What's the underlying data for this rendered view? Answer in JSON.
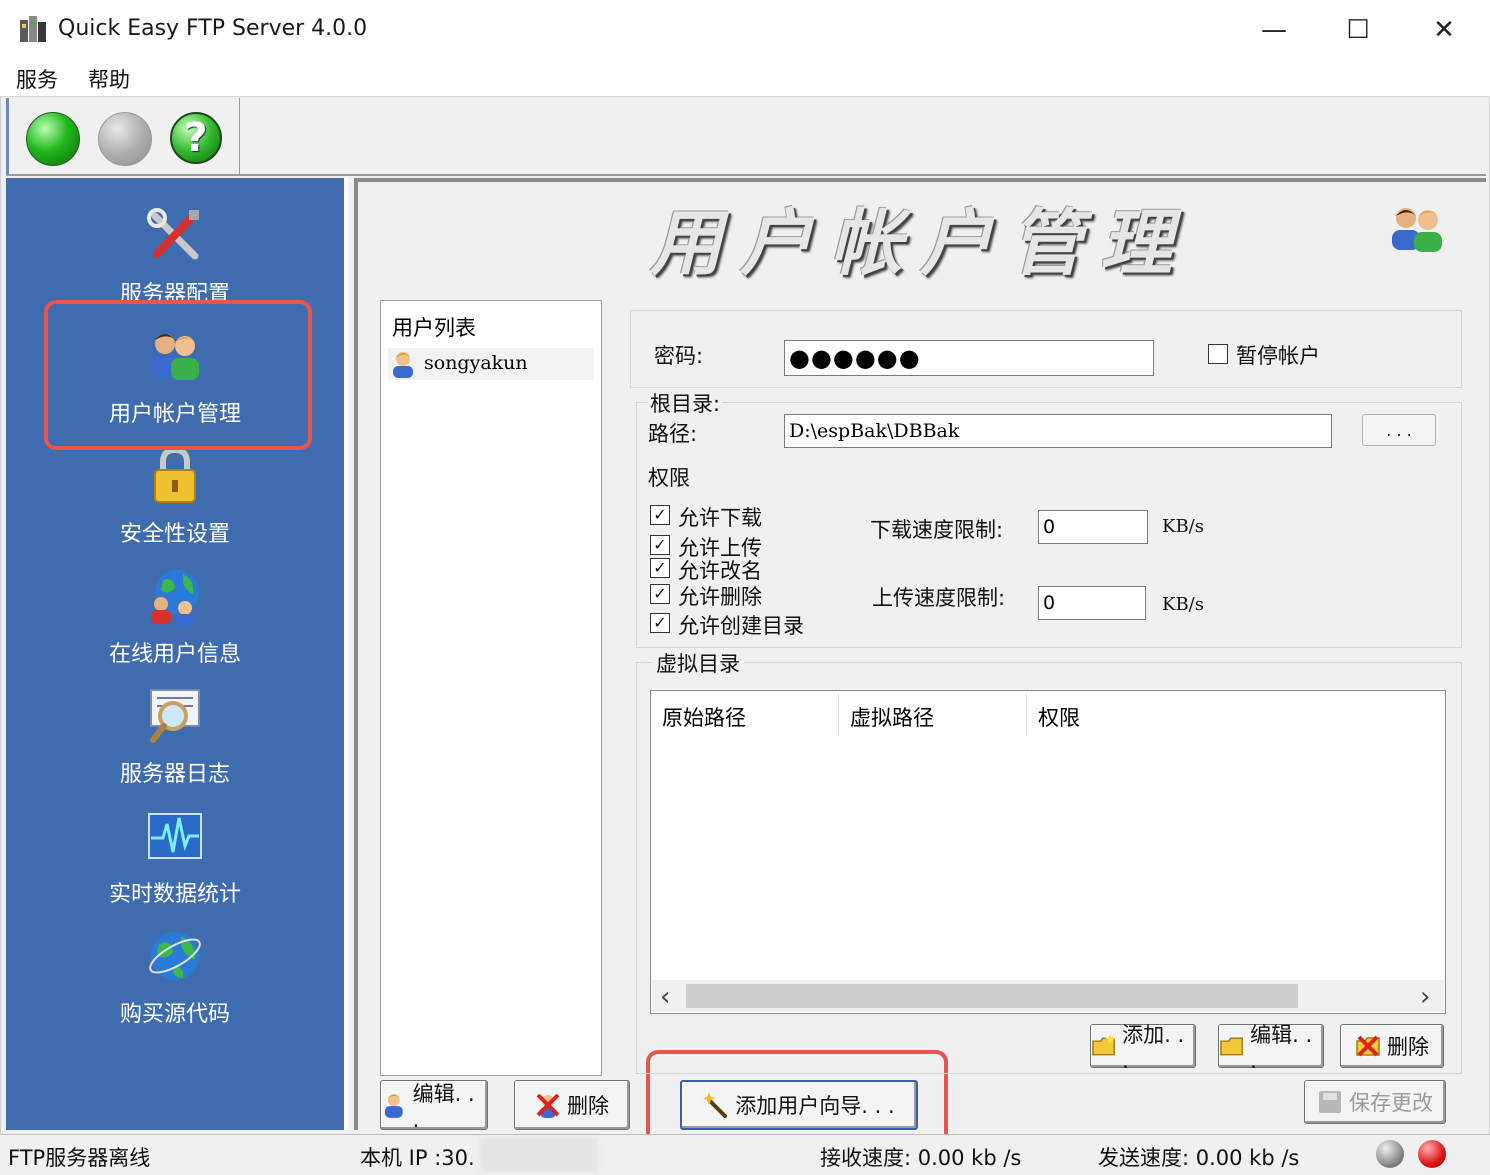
{
  "window": {
    "title": "Quick Easy FTP Server 4.0.0",
    "minimize": "—",
    "maximize": "☐",
    "close": "✕"
  },
  "menu": [
    "服务",
    "帮助"
  ],
  "toolbar": {
    "start_icon": "green-circle-icon",
    "stop_icon": "gray-circle-icon",
    "help_icon": "help-icon",
    "help_glyph": "?"
  },
  "sidebar": {
    "items": [
      {
        "label": "服务器配置",
        "icon": "tools-icon"
      },
      {
        "label": "用户帐户管理",
        "icon": "users-icon"
      },
      {
        "label": "安全性设置",
        "icon": "lock-icon"
      },
      {
        "label": "在线用户信息",
        "icon": "globe-users-icon"
      },
      {
        "label": "服务器日志",
        "icon": "log-magnifier-icon"
      },
      {
        "label": "实时数据统计",
        "icon": "pulse-icon"
      },
      {
        "label": "购买源代码",
        "icon": "globe-icon"
      }
    ],
    "selected": 1
  },
  "main": {
    "banner_title": "用户帐户管理",
    "user_list": {
      "header": "用户列表",
      "users": [
        "songyakun"
      ],
      "edit_button": "编辑. . .",
      "delete_button": "删除",
      "wizard_button": "添加用户向导. . ."
    },
    "password": {
      "label": "密码:",
      "value": "●●●●●●",
      "suspend_label": "暂停帐户",
      "suspend_checked": false
    },
    "root": {
      "group_label": "根目录:",
      "path_label": "路径:",
      "path_value": "D:\\espBak\\DBBak",
      "browse_button": ". . ."
    },
    "permissions": {
      "label": "权限",
      "items": [
        {
          "label": "允许下载",
          "checked": true
        },
        {
          "label": "允许上传",
          "checked": true
        },
        {
          "label": "允许改名",
          "checked": true
        },
        {
          "label": "允许删除",
          "checked": true
        },
        {
          "label": "允许创建目录",
          "checked": true
        }
      ],
      "check_mark": "✓",
      "download_limit_label": "下载速度限制:",
      "download_limit_value": "0",
      "upload_limit_label": "上传速度限制:",
      "upload_limit_value": "0",
      "unit": "KB/s"
    },
    "virtual_dir": {
      "label": "虚拟目录",
      "columns": [
        "原始路径",
        "虚拟路径",
        "权限"
      ],
      "scroll_left": "‹",
      "scroll_right": "›",
      "add_button": "添加. . .",
      "edit_button": "编辑. . .",
      "delete_button": "删除"
    },
    "save_button": "保存更改"
  },
  "status_bar": {
    "server_status": "FTP服务器离线",
    "local_ip": "本机 IP :30.",
    "recv_speed": "接收速度: 0.00   kb /s",
    "send_speed": "发送速度:  0.00   kb /s"
  },
  "colors": {
    "sidebar_bg": "#3f6cae",
    "highlight": "#e8554f",
    "green_light": "#22b81e"
  }
}
